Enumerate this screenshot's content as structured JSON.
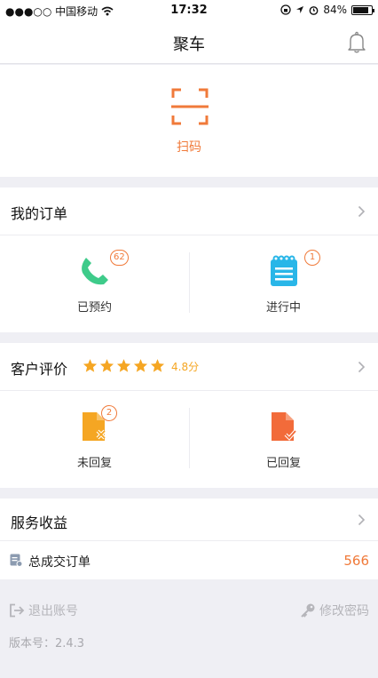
{
  "status_bar": {
    "carrier": "●●●○○ 中国移动",
    "time": "17:32",
    "battery": "84%",
    "battery_level": 0.84
  },
  "nav": {
    "title": "聚车",
    "bell_icon": "bell-icon"
  },
  "scan": {
    "label": "扫码",
    "icon": "scan-icon",
    "color": "#f07a3a"
  },
  "orders": {
    "title": "我的订单",
    "items": [
      {
        "label": "已预约",
        "badge": "62",
        "icon": "phone-icon",
        "color": "#3ecb8a"
      },
      {
        "label": "进行中",
        "badge": "1",
        "icon": "notepad-icon",
        "color": "#29b6e8"
      }
    ]
  },
  "reviews": {
    "title": "客户评价",
    "rating": "4.8分",
    "stars": 5,
    "star_color": "#f5a623",
    "items": [
      {
        "label": "未回复",
        "badge": "2",
        "icon": "document-cross-icon",
        "color": "#f5a623"
      },
      {
        "label": "已回复",
        "icon": "document-check-icon",
        "color": "#f26b3a"
      }
    ]
  },
  "income": {
    "title": "服务收益",
    "row_label": "总成交订单",
    "row_value": "566"
  },
  "footer": {
    "logout": "退出账号",
    "change_password": "修改密码",
    "version": "版本号：2.4.3"
  },
  "colors": {
    "accent": "#f07a3a",
    "background": "#efeff4"
  }
}
